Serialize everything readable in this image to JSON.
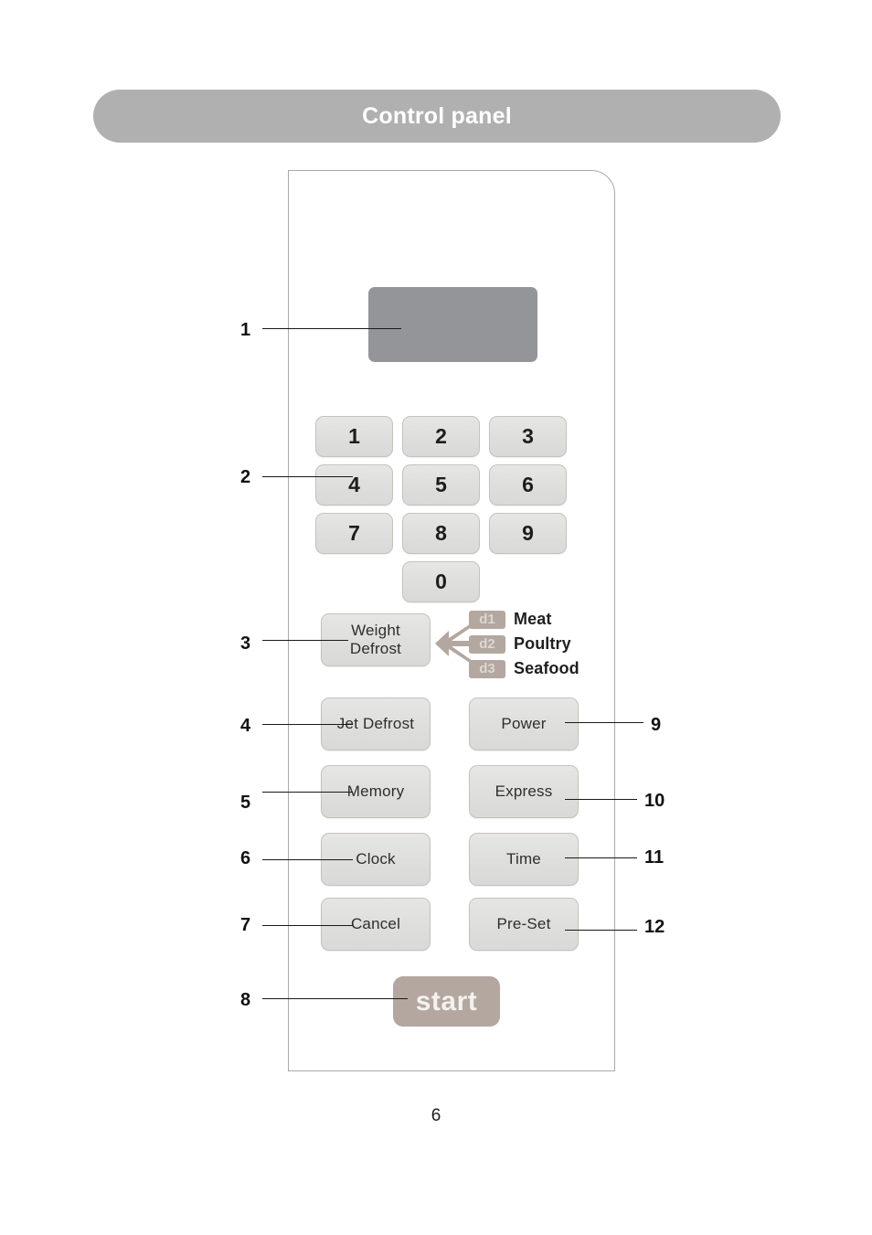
{
  "header": {
    "title": "Control panel",
    "bar_color": "#b0b0b0",
    "text_color": "#ffffff"
  },
  "panel": {
    "display": {
      "name": "display-window",
      "color": "#939598"
    },
    "keypad": {
      "keys": [
        "1",
        "2",
        "3",
        "4",
        "5",
        "6",
        "7",
        "8",
        "9",
        "0"
      ]
    },
    "weight_defrost": {
      "line1": "Weight",
      "line2": "Defrost"
    },
    "defrost_legend": [
      {
        "code": "d1",
        "label": "Meat"
      },
      {
        "code": "d2",
        "label": "Poultry"
      },
      {
        "code": "d3",
        "label": "Seafood"
      }
    ],
    "function_keys_left": [
      {
        "label": "Jet Defrost"
      },
      {
        "label": "Memory"
      },
      {
        "label": "Clock"
      },
      {
        "label": "Cancel"
      }
    ],
    "function_keys_right": [
      {
        "label": "Power"
      },
      {
        "label": "Express"
      },
      {
        "label": "Time"
      },
      {
        "label": "Pre-Set"
      }
    ],
    "start_key": {
      "label": "start",
      "color": "#b3a79f"
    },
    "key_color": "#dededd",
    "accent_color": "#b3a79f"
  },
  "callouts": {
    "left": [
      "1",
      "2",
      "3",
      "4",
      "5",
      "6",
      "7",
      "8"
    ],
    "right": [
      "9",
      "10",
      "11",
      "12"
    ]
  },
  "footer": {
    "page_number": "6"
  }
}
